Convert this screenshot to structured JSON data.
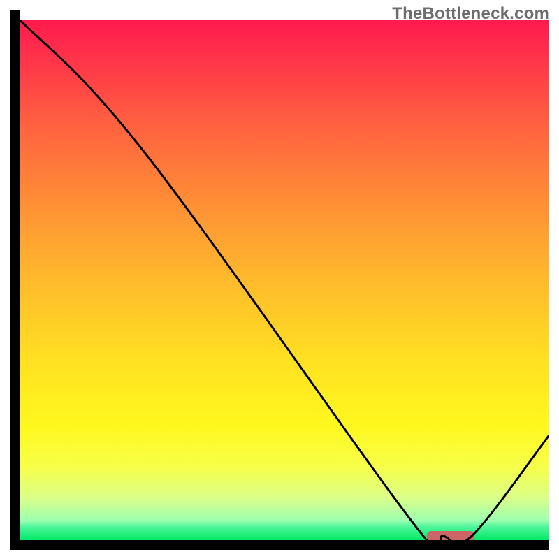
{
  "watermark": "TheBottleneck.com",
  "chart_data": {
    "type": "line",
    "title": "",
    "xlabel": "",
    "ylabel": "",
    "xlim": [
      0,
      100
    ],
    "ylim": [
      0,
      100
    ],
    "x": [
      0,
      24,
      75,
      80,
      85.5,
      100
    ],
    "values": [
      100,
      74,
      2.5,
      0.8,
      0.8,
      20
    ],
    "optimal_zone": {
      "x_start": 77,
      "x_end": 86,
      "y": 0.8,
      "color": "#cc6666"
    },
    "green_band": {
      "y_bottom": 0,
      "y_top": 2.5,
      "color": "#00e965"
    },
    "gradient_stops": [
      {
        "offset": 0.0,
        "color": "#ff1a4d"
      },
      {
        "offset": 0.06,
        "color": "#ff2e4b"
      },
      {
        "offset": 0.2,
        "color": "#ff6140"
      },
      {
        "offset": 0.35,
        "color": "#ff8e36"
      },
      {
        "offset": 0.5,
        "color": "#ffba2c"
      },
      {
        "offset": 0.65,
        "color": "#ffe022"
      },
      {
        "offset": 0.78,
        "color": "#fff81e"
      },
      {
        "offset": 0.86,
        "color": "#f7ff4a"
      },
      {
        "offset": 0.92,
        "color": "#d9ff8a"
      },
      {
        "offset": 0.962,
        "color": "#9dffb0"
      },
      {
        "offset": 0.975,
        "color": "#4df59a"
      },
      {
        "offset": 1.0,
        "color": "#00e965"
      }
    ]
  }
}
